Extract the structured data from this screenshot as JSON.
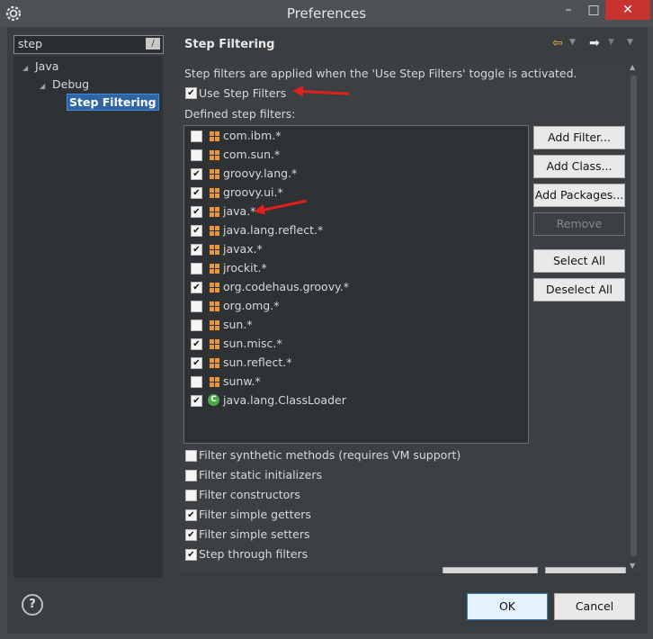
{
  "window": {
    "title": "Preferences"
  },
  "search": {
    "value": "step"
  },
  "tree": {
    "items": [
      {
        "label": "Java"
      },
      {
        "label": "Debug"
      },
      {
        "label": "Step Filtering"
      }
    ]
  },
  "page": {
    "title": "Step Filtering",
    "description": "Step filters are applied when the 'Use Step Filters' toggle is activated.",
    "use_step_filters": {
      "label": "Use Step Filters",
      "checked": true
    },
    "defined_label": "Defined step filters:"
  },
  "filters": [
    {
      "name": "com.ibm.*",
      "checked": false,
      "icon": "package-icon"
    },
    {
      "name": "com.sun.*",
      "checked": false,
      "icon": "package-icon"
    },
    {
      "name": "groovy.lang.*",
      "checked": true,
      "icon": "package-icon"
    },
    {
      "name": "groovy.ui.*",
      "checked": true,
      "icon": "package-icon"
    },
    {
      "name": "java.*",
      "checked": true,
      "icon": "package-icon"
    },
    {
      "name": "java.lang.reflect.*",
      "checked": true,
      "icon": "package-icon"
    },
    {
      "name": "javax.*",
      "checked": true,
      "icon": "package-icon"
    },
    {
      "name": "jrockit.*",
      "checked": false,
      "icon": "package-icon"
    },
    {
      "name": "org.codehaus.groovy.*",
      "checked": true,
      "icon": "package-icon"
    },
    {
      "name": "org.omg.*",
      "checked": false,
      "icon": "package-icon"
    },
    {
      "name": "sun.*",
      "checked": false,
      "icon": "package-icon"
    },
    {
      "name": "sun.misc.*",
      "checked": true,
      "icon": "package-icon"
    },
    {
      "name": "sun.reflect.*",
      "checked": true,
      "icon": "package-icon"
    },
    {
      "name": "sunw.*",
      "checked": false,
      "icon": "package-icon"
    },
    {
      "name": "java.lang.ClassLoader",
      "checked": true,
      "icon": "class-icon"
    }
  ],
  "buttons": {
    "add_filter": "Add Filter...",
    "add_class": "Add Class...",
    "add_packages": "Add Packages...",
    "remove": "Remove",
    "select_all": "Select All",
    "deselect_all": "Deselect All"
  },
  "options": [
    {
      "label": "Filter synthetic methods (requires VM support)",
      "checked": false
    },
    {
      "label": "Filter static initializers",
      "checked": false
    },
    {
      "label": "Filter constructors",
      "checked": false
    },
    {
      "label": "Filter simple getters",
      "checked": true
    },
    {
      "label": "Filter simple setters",
      "checked": true
    },
    {
      "label": "Step through filters",
      "checked": true
    }
  ],
  "dialog": {
    "ok": "OK",
    "cancel": "Cancel"
  },
  "colors": {
    "accent": "#2f65a3",
    "annotation": "#e0201b",
    "package_icon": "#e8963a",
    "class_icon": "#4aa944"
  }
}
